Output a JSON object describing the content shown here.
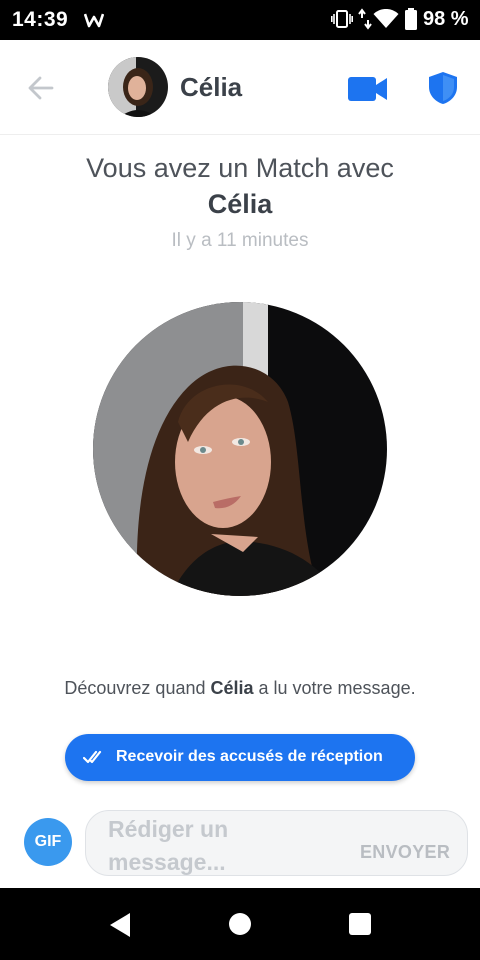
{
  "status_bar": {
    "time": "14:39",
    "battery": "98 %",
    "icons": [
      "w-app-icon",
      "vibrate-icon",
      "data-icon",
      "wifi-icon",
      "battery-icon"
    ]
  },
  "header": {
    "name": "Célia",
    "icons": [
      "back-arrow-icon",
      "video-camera-icon",
      "shield-icon"
    ],
    "accent_color": "#1d74f0"
  },
  "match": {
    "title": "Vous avez un Match avec",
    "name": "Célia",
    "time_ago": "Il y a 11 minutes"
  },
  "read_receipts": {
    "text_before": "Découvrez quand ",
    "name": "Célia",
    "text_after": " a lu votre message.",
    "button_label": "Recevoir des accusés de réception",
    "button_icon": "double-check-icon",
    "button_color": "#1d74f0"
  },
  "composer": {
    "gif_label": "GIF",
    "placeholder": "Rédiger un message...",
    "send_label": "ENVOYER"
  },
  "nav_bar": {
    "icons": [
      "nav-back-icon",
      "nav-home-icon",
      "nav-recents-icon"
    ]
  }
}
